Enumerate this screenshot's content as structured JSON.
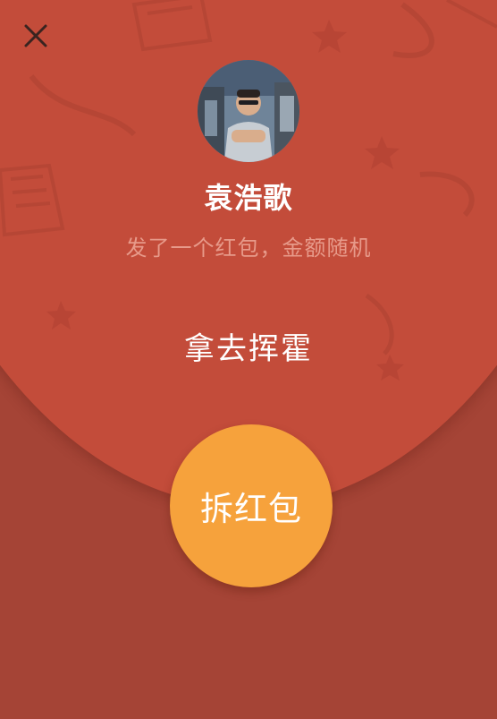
{
  "window": {
    "close_icon": "close-icon"
  },
  "sender": {
    "avatar_icon": "user-avatar-photo",
    "name": "袁浩歌",
    "subtitle": "发了一个红包，金额随机"
  },
  "message": {
    "greeting": "拿去挥霍"
  },
  "action": {
    "open_label": "拆红包"
  },
  "colors": {
    "envelope_top": "#c34c3a",
    "envelope_bottom": "#a54436",
    "open_button": "#f6a23c",
    "subtitle_text": "#e79a8a"
  }
}
